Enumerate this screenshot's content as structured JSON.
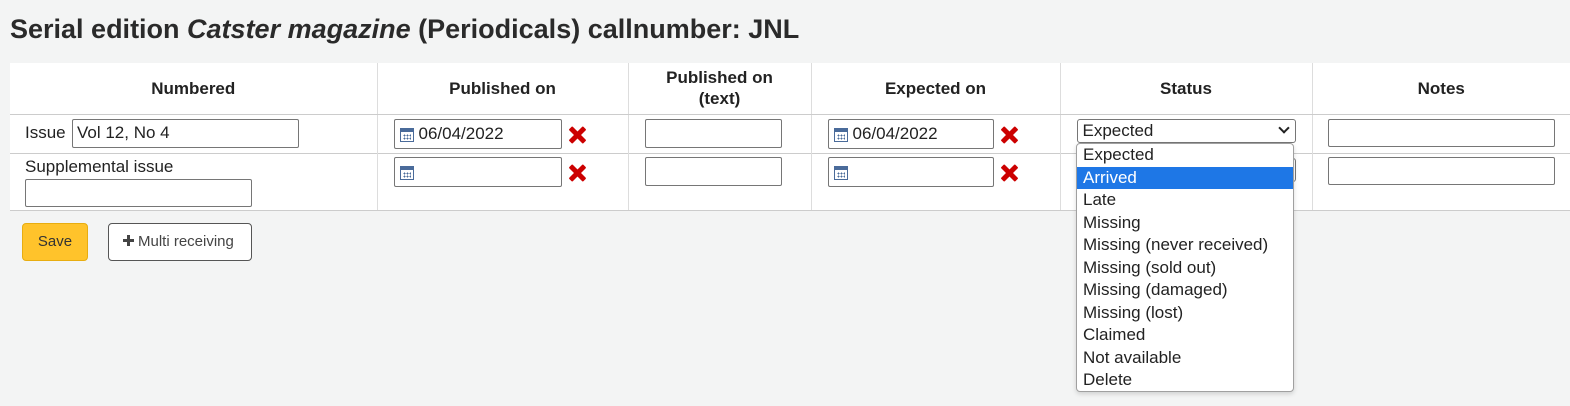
{
  "heading": {
    "prefix": "Serial edition ",
    "title": "Catster magazine",
    "suffix": " (Periodicals) callnumber: JNL"
  },
  "table": {
    "headers": [
      "Numbered",
      "Published on",
      "Published on (text)",
      "Expected on",
      "Status",
      "Notes"
    ],
    "rows": [
      {
        "label": "Issue",
        "numbered_value": "Vol 12, No 4",
        "published_on": "06/04/2022",
        "published_text": "",
        "expected_on": "06/04/2022",
        "status": "Expected",
        "notes": ""
      },
      {
        "label": "Supplemental issue",
        "numbered_value": "",
        "published_on": "",
        "published_text": "",
        "expected_on": "",
        "status": "",
        "notes": ""
      }
    ]
  },
  "status_options": [
    "Expected",
    "Arrived",
    "Late",
    "Missing",
    "Missing (never received)",
    "Missing (sold out)",
    "Missing (damaged)",
    "Missing (lost)",
    "Claimed",
    "Not available",
    "Delete"
  ],
  "highlighted_option": "Arrived",
  "buttons": {
    "save": "Save",
    "multi_receiving": "Multi receiving"
  },
  "colors": {
    "save_button": "#ffc32b",
    "clear_icon": "#cc0000",
    "highlight": "#1e77e6"
  }
}
